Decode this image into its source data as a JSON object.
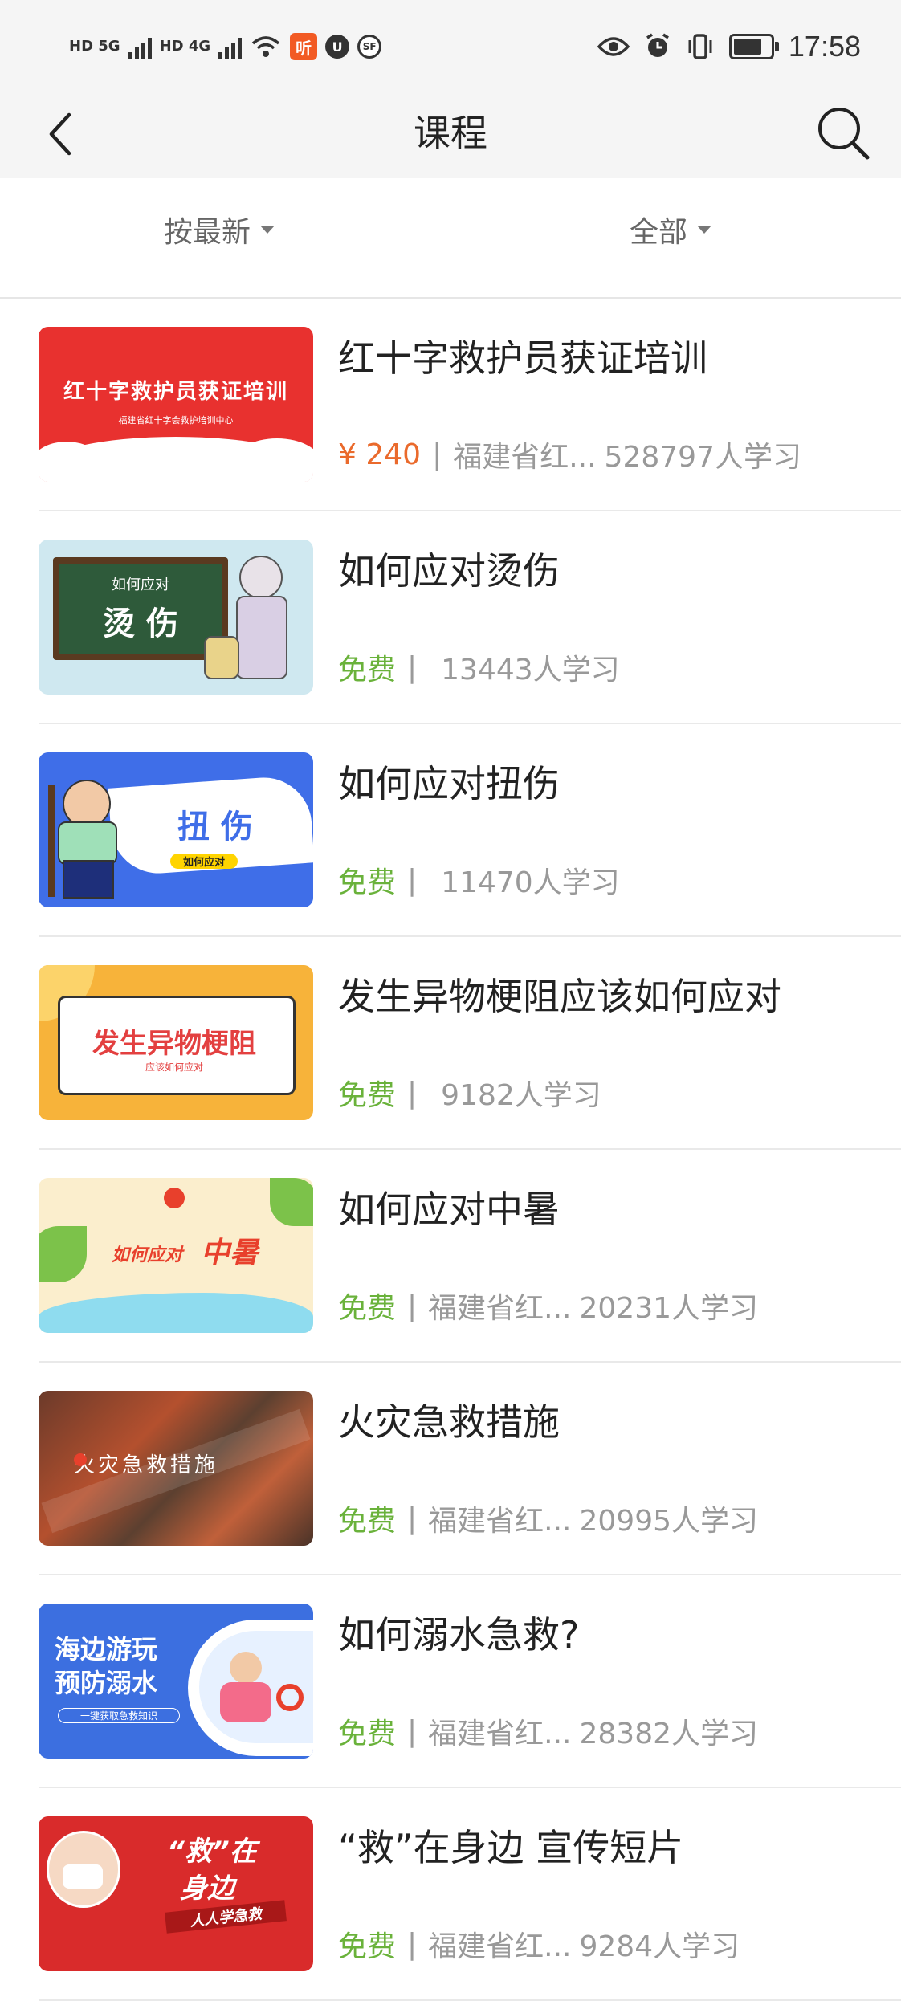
{
  "status_bar": {
    "network_left": "HD 5G",
    "network_right": "HD 4G",
    "listen_badge": "听",
    "badge_a": "U",
    "badge_b": "SF",
    "time": "17:58"
  },
  "nav": {
    "title": "课程"
  },
  "filters": {
    "sort_label": "按最新",
    "category_label": "全部"
  },
  "courses": [
    {
      "title": "红十字救护员获证培训",
      "price": "¥ 240",
      "org": "福建省红...",
      "learners": "528797人学习",
      "thumb_text": "红十字救护员获证培训",
      "thumb_sub": "福建省红十字会救护培训中心"
    },
    {
      "title": "如何应对烫伤",
      "price": "免费",
      "org": "",
      "learners": "13443人学习",
      "thumb_text": "烫 伤",
      "thumb_sub": "如何应对"
    },
    {
      "title": "如何应对扭伤",
      "price": "免费",
      "org": "",
      "learners": "11470人学习",
      "thumb_text": "扭 伤",
      "thumb_sub": "如何应对"
    },
    {
      "title": "发生异物梗阻应该如何应对",
      "price": "免费",
      "org": "",
      "learners": "9182人学习",
      "thumb_text": "发生异物梗阻",
      "thumb_sub": "应该如何应对"
    },
    {
      "title": "如何应对中暑",
      "price": "免费",
      "org": "福建省红...",
      "learners": "20231人学习",
      "thumb_text": "中暑",
      "thumb_sub": "如何应对"
    },
    {
      "title": "火灾急救措施",
      "price": "免费",
      "org": "福建省红...",
      "learners": "20995人学习",
      "thumb_text": "火灾急救措施",
      "thumb_sub": ""
    },
    {
      "title": "如何溺水急救?",
      "price": "免费",
      "org": "福建省红...",
      "learners": "28382人学习",
      "thumb_text": "海边游玩",
      "thumb_sub": "预防溺水",
      "thumb_sub2": "一键获取急救知识"
    },
    {
      "title": "“救”在身边 宣传短片",
      "price": "免费",
      "org": "福建省红...",
      "learners": "9284人学习",
      "thumb_text": "“救”在",
      "thumb_sub": "身边",
      "thumb_sub2": "人人学急救"
    }
  ],
  "colors": {
    "price": "#ea6a2c",
    "free": "#6ab23b",
    "bar_bg": "#f5f5f5"
  }
}
